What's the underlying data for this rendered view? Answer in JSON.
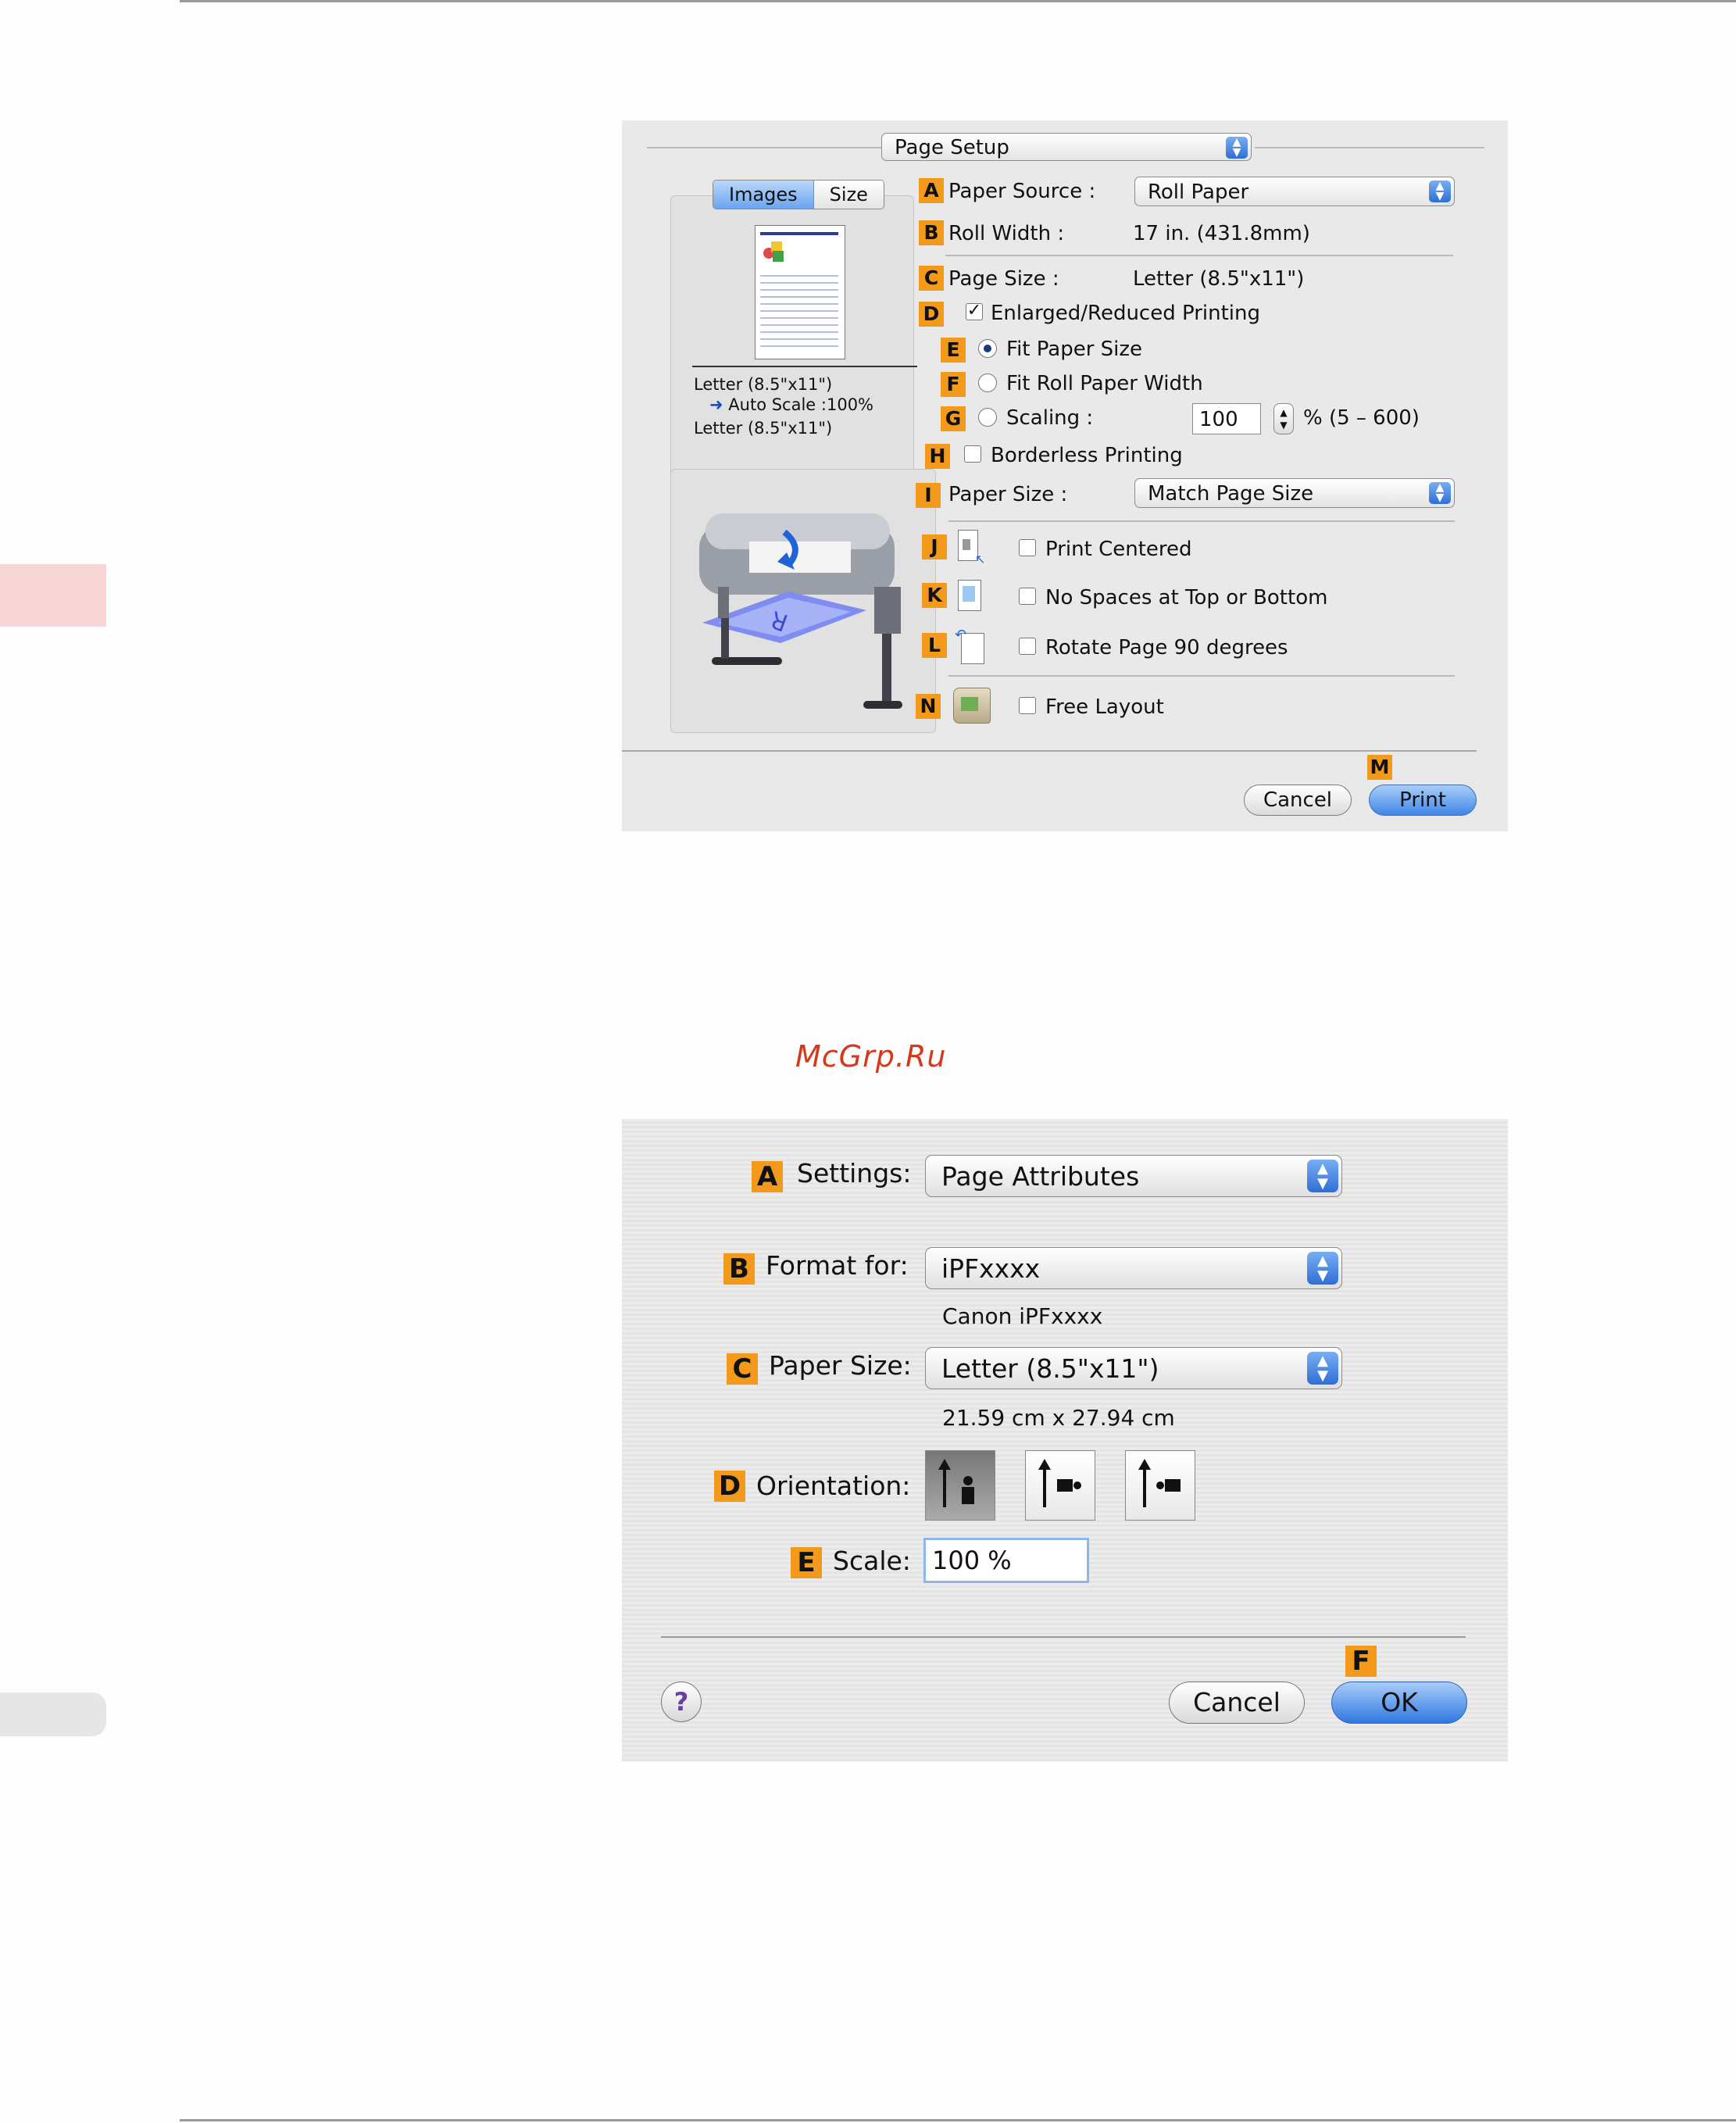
{
  "watermark": "McGrp.Ru",
  "dialog1": {
    "title_popup": "Page Setup",
    "tabs": {
      "images": "Images",
      "size": "Size"
    },
    "preview": {
      "line1": "Letter (8.5\"x11\")",
      "line2": "Auto Scale :100%",
      "line3": "Letter (8.5\"x11\")"
    },
    "badges": [
      "A",
      "B",
      "C",
      "D",
      "E",
      "F",
      "G",
      "H",
      "I",
      "J",
      "K",
      "L",
      "N",
      "M"
    ],
    "paper_source": {
      "label": "Paper Source :",
      "value": "Roll Paper"
    },
    "roll_width": {
      "label": "Roll Width :",
      "value": "17 in. (431.8mm)"
    },
    "page_size": {
      "label": "Page Size :",
      "value": "Letter (8.5\"x11\")"
    },
    "enlarged": {
      "label": "Enlarged/Reduced Printing",
      "checked": true
    },
    "fit_paper": {
      "label": "Fit Paper Size",
      "selected": true
    },
    "fit_roll": {
      "label": "Fit Roll Paper Width"
    },
    "scaling": {
      "label": "Scaling :",
      "value": "100",
      "range": "% (5 – 600)"
    },
    "borderless": {
      "label": "Borderless Printing"
    },
    "paper_size": {
      "label": "Paper Size :",
      "value": "Match Page Size"
    },
    "print_centered": {
      "label": "Print Centered"
    },
    "no_spaces": {
      "label": "No Spaces at Top or Bottom"
    },
    "rotate": {
      "label": "Rotate Page 90 degrees"
    },
    "free_layout": {
      "label": "Free Layout"
    },
    "cancel": "Cancel",
    "print": "Print"
  },
  "dialog2": {
    "badges": [
      "A",
      "B",
      "C",
      "D",
      "E",
      "F"
    ],
    "settings": {
      "label": "Settings:",
      "value": "Page Attributes"
    },
    "format_for": {
      "label": "Format for:",
      "value": "iPFxxxx",
      "sub": "Canon iPFxxxx"
    },
    "paper_size": {
      "label": "Paper Size:",
      "value": "Letter (8.5\"x11\")",
      "sub": "21.59 cm x 27.94 cm"
    },
    "orientation": {
      "label": "Orientation:"
    },
    "scale": {
      "label": "Scale:",
      "value": "100 %"
    },
    "help": "?",
    "cancel": "Cancel",
    "ok": "OK"
  }
}
